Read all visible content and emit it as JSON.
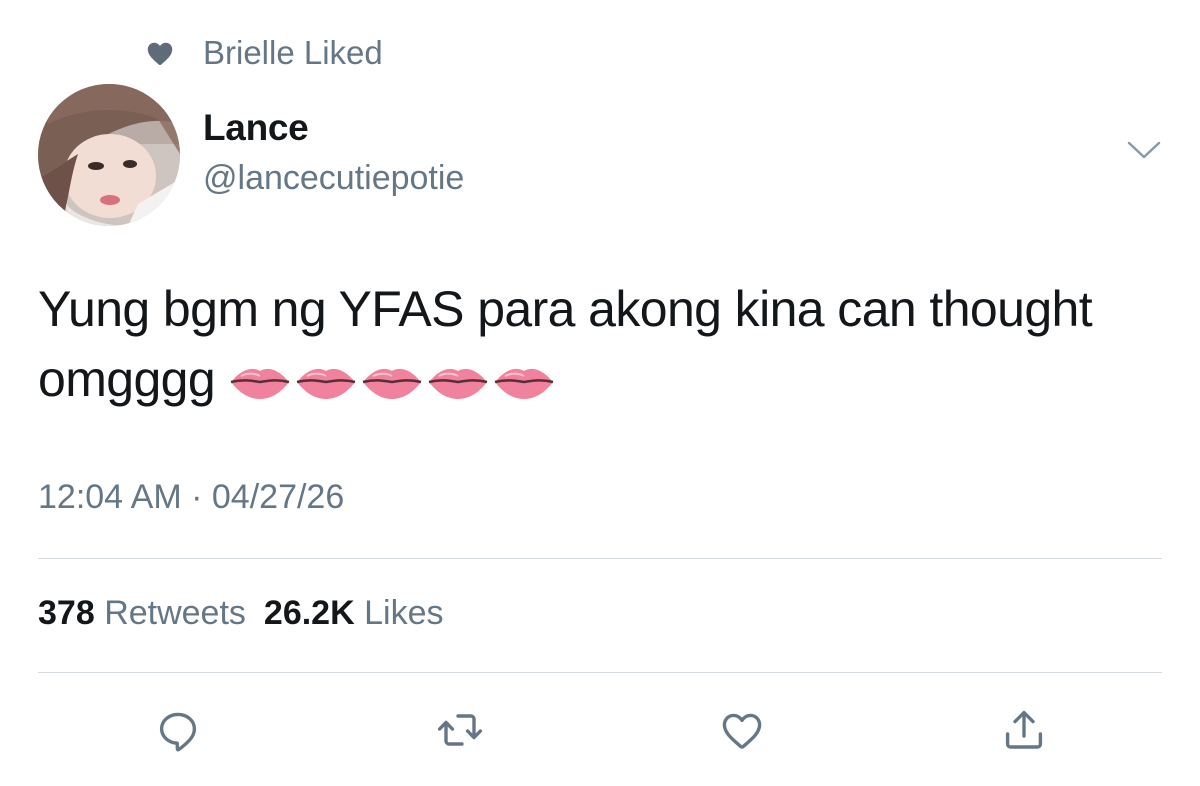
{
  "social_context": {
    "icon": "heart-icon",
    "text": "Brielle Liked"
  },
  "tweet": {
    "author": {
      "display_name": "Lance",
      "handle": "@lancecutiepotie"
    },
    "text": "Yung bgm ng YFAS para akong kina can thought omgggg",
    "emoji": [
      "lips",
      "lips",
      "lips",
      "lips",
      "lips"
    ],
    "time": "12:04 AM",
    "date": "04/27/26",
    "separator": "·"
  },
  "stats": {
    "retweets_count": "378",
    "retweets_label": "Retweets",
    "likes_count": "26.2K",
    "likes_label": "Likes"
  },
  "actions": [
    "reply-icon",
    "retweet-icon",
    "like-icon",
    "share-icon"
  ],
  "colors": {
    "primary_text": "#14171a",
    "secondary_text": "#657786",
    "divider": "#d6dbe0"
  }
}
